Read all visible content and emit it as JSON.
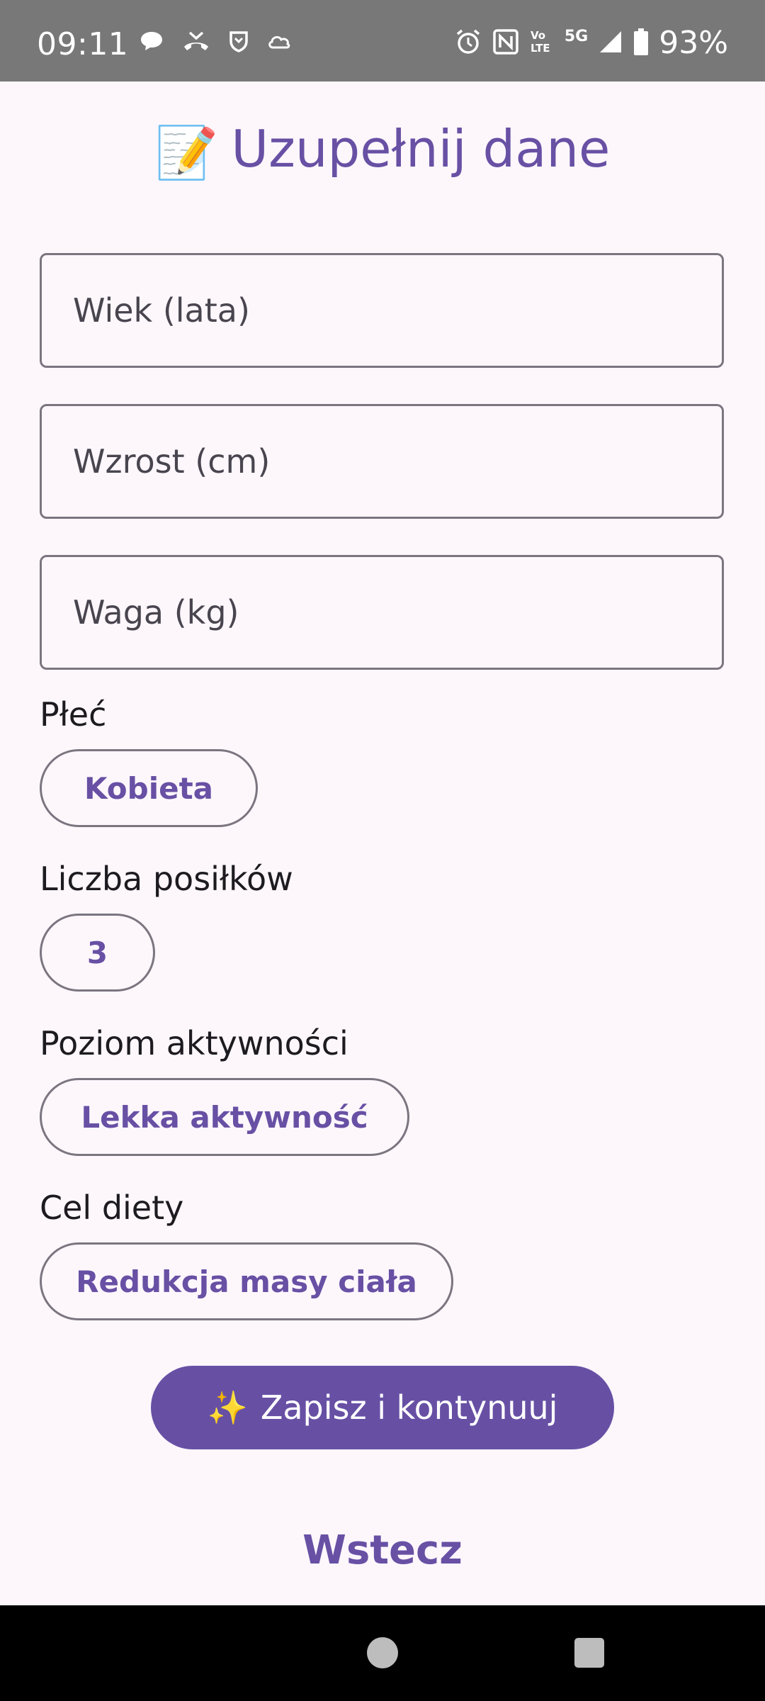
{
  "status_bar": {
    "time": "09:11",
    "left_icons": [
      "chat-bubble-icon",
      "missed-call-icon",
      "shield-icon",
      "cloud-icon"
    ],
    "right_icons": [
      "alarm-icon",
      "nfc-icon",
      "volte-icon",
      "signal-icon",
      "battery-icon"
    ],
    "network": "5G",
    "volte": "Vo LTE",
    "battery": "93%"
  },
  "header": {
    "emoji": "📝",
    "title": "Uzupełnij dane"
  },
  "form": {
    "age_placeholder": "Wiek (lata)",
    "height_placeholder": "Wzrost (cm)",
    "weight_placeholder": "Waga (kg)",
    "gender": {
      "label": "Płeć",
      "value": "Kobieta"
    },
    "meals": {
      "label": "Liczba posiłków",
      "value": "3"
    },
    "activity": {
      "label": "Poziom aktywności",
      "value": "Lekka aktywność"
    },
    "goal": {
      "label": "Cel diety",
      "value": "Redukcja masy ciała"
    }
  },
  "actions": {
    "save_emoji": "✨",
    "save_label": "Zapisz i kontynuuj",
    "back_label": "Wstecz"
  },
  "colors": {
    "accent": "#6750a4",
    "background": "#fdf7fc",
    "outline": "#7a757f",
    "status_bar": "#787878"
  }
}
